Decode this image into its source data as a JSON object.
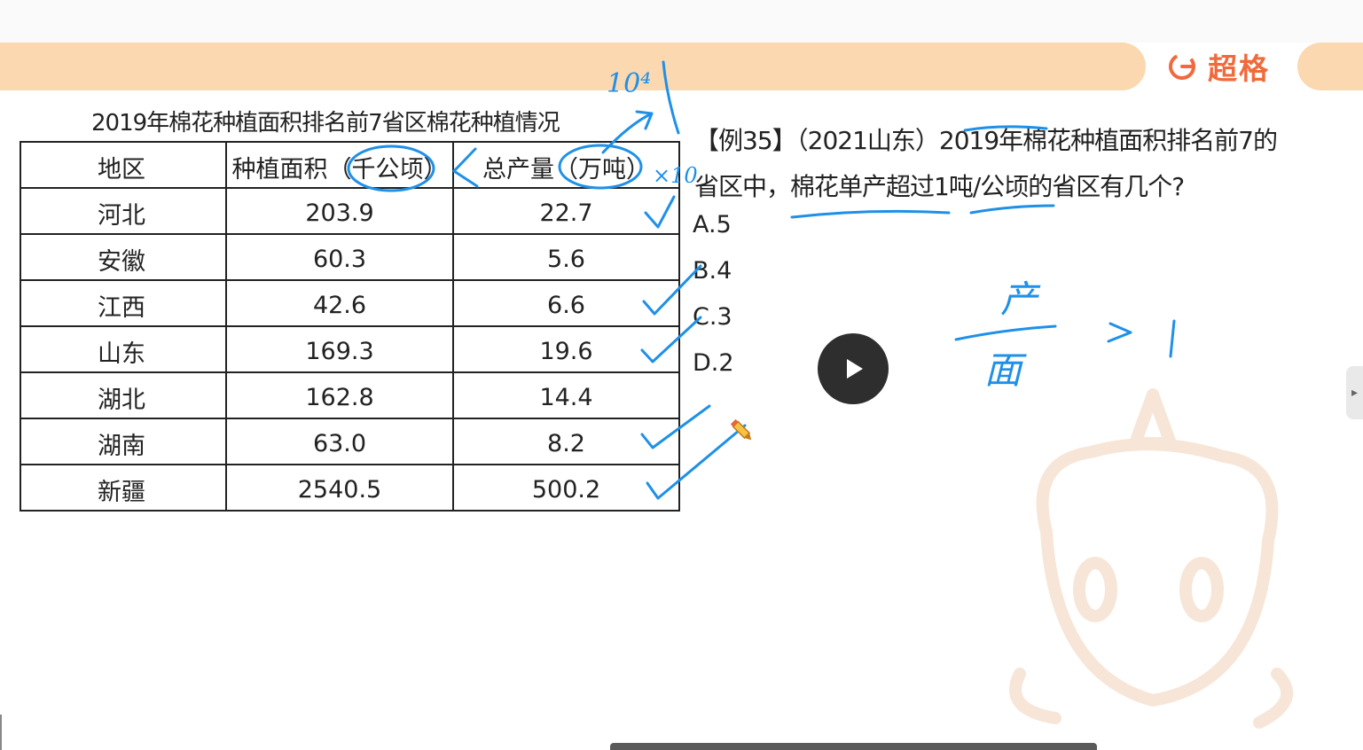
{
  "brand": {
    "name": "超格"
  },
  "table": {
    "title": "2019年棉花种植面积排名前7省区棉花种植情况",
    "headers": [
      "地区",
      "种植面积（千公顷）",
      "总产量（万吨）"
    ],
    "rows": [
      {
        "region": "河北",
        "area": "203.9",
        "output": "22.7"
      },
      {
        "region": "安徽",
        "area": "60.3",
        "output": "5.6"
      },
      {
        "region": "江西",
        "area": "42.6",
        "output": "6.6"
      },
      {
        "region": "山东",
        "area": "169.3",
        "output": "19.6"
      },
      {
        "region": "湖北",
        "area": "162.8",
        "output": "14.4"
      },
      {
        "region": "湖南",
        "area": "63.0",
        "output": "8.2"
      },
      {
        "region": "新疆",
        "area": "2540.5",
        "output": "500.2"
      }
    ]
  },
  "question": {
    "line1": "【例35】（2021山东）2019年棉花种植面积排名前7的",
    "line2": "省区中，棉花单产超过1吨/公顷的省区有几个?",
    "options": [
      "A.5",
      "B.4",
      "C.3",
      "D.2"
    ]
  },
  "handwriting": {
    "ten_thousand": "10⁴",
    "times_ten": "×10",
    "production": "产",
    "area": "面",
    "greater_than": ">",
    "one": "1"
  },
  "colors": {
    "ink": "#1e90e8",
    "brand": "#f06a3c",
    "banner": "#fbd8b0"
  }
}
